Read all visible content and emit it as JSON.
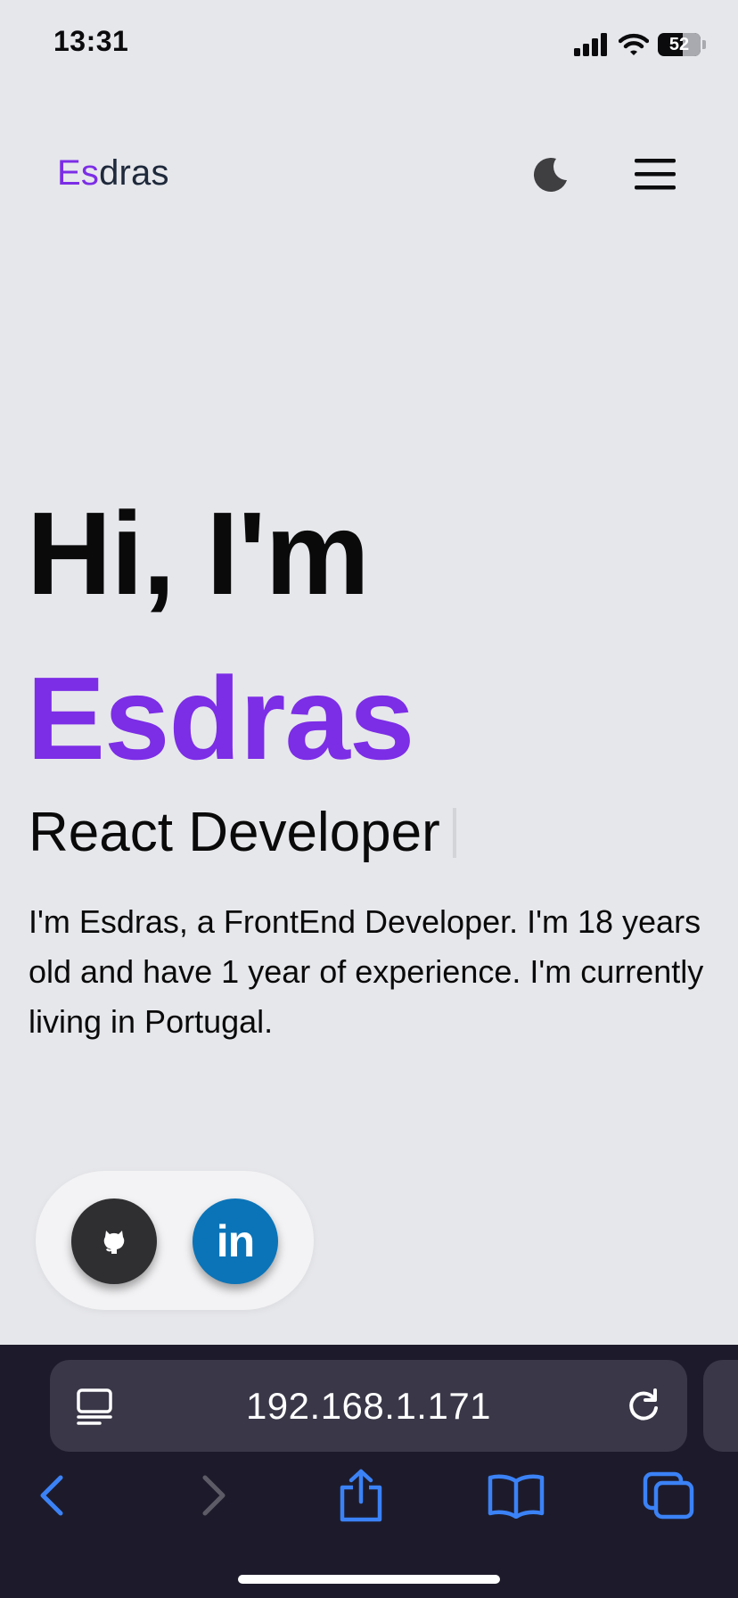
{
  "status_bar": {
    "time": "13:31",
    "battery": "52"
  },
  "header": {
    "logo_accent": "Es",
    "logo_rest": "dras",
    "theme_toggle_icon": "moon-icon",
    "menu_icon": "hamburger-menu-icon"
  },
  "hero": {
    "greeting": "Hi, I'm",
    "name": "Esdras",
    "role": "React Developer",
    "description": "I'm Esdras, a FrontEnd Developer. I'm 18 years old and have 1 year of experience. I'm currently living in Portugal."
  },
  "social": {
    "github_icon": "github-icon",
    "linkedin_label": "in"
  },
  "browser": {
    "url": "192.168.1.171"
  },
  "colors": {
    "accent": "#7c2de6",
    "background": "#e6e7eb",
    "linkedin": "#0b74b8",
    "github": "#2f2f31",
    "browser_chrome": "#1d1b2b",
    "browser_blue": "#3b82f6"
  }
}
